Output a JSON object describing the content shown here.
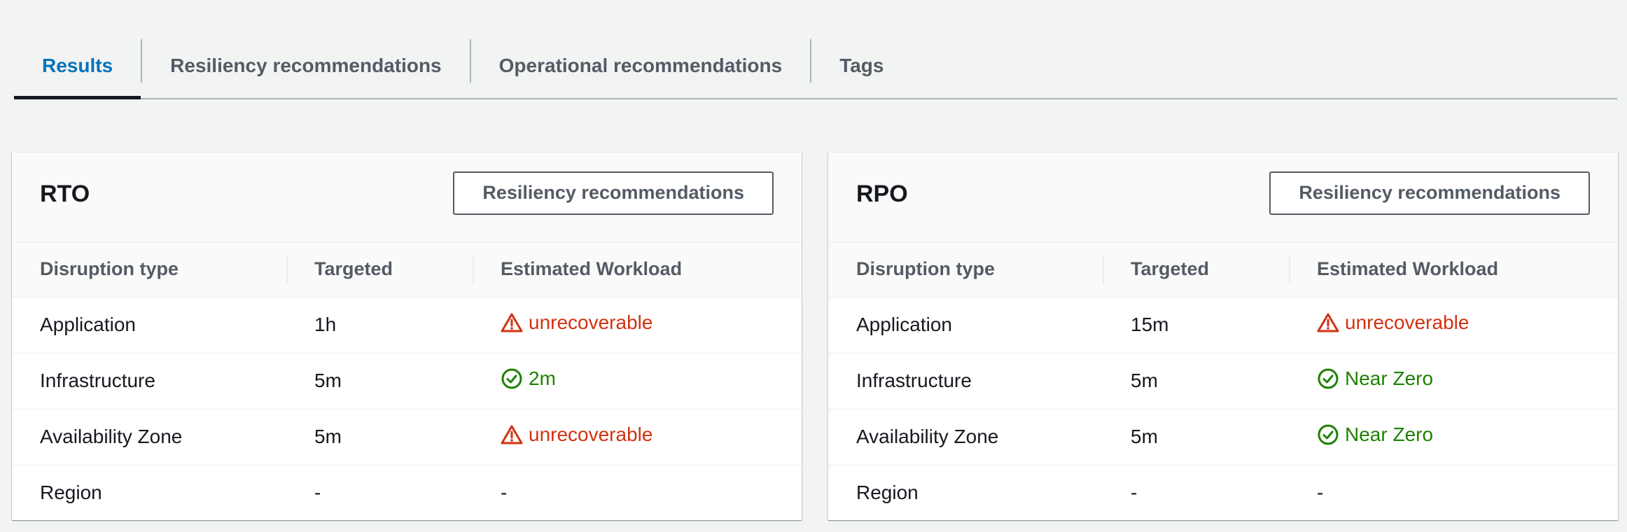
{
  "tabs": [
    {
      "label": "Results",
      "active": true
    },
    {
      "label": "Resiliency recommendations",
      "active": false
    },
    {
      "label": "Operational recommendations",
      "active": false
    },
    {
      "label": "Tags",
      "active": false
    }
  ],
  "columns": {
    "disruption_type": "Disruption type",
    "targeted": "Targeted",
    "estimated": "Estimated Workload"
  },
  "rto": {
    "title": "RTO",
    "button": "Resiliency recommendations",
    "rows": [
      {
        "type": "Application",
        "targeted": "1h",
        "estimate": "unrecoverable",
        "status": "warning-icon"
      },
      {
        "type": "Infrastructure",
        "targeted": "5m",
        "estimate": "2m",
        "status": "check-circle-icon"
      },
      {
        "type": "Availability Zone",
        "targeted": "5m",
        "estimate": "unrecoverable",
        "status": "warning-icon"
      },
      {
        "type": "Region",
        "targeted": "-",
        "estimate": "-",
        "status": "none"
      }
    ]
  },
  "rpo": {
    "title": "RPO",
    "button": "Resiliency recommendations",
    "rows": [
      {
        "type": "Application",
        "targeted": "15m",
        "estimate": "unrecoverable",
        "status": "warning-icon"
      },
      {
        "type": "Infrastructure",
        "targeted": "5m",
        "estimate": "Near Zero",
        "status": "check-circle-icon"
      },
      {
        "type": "Availability Zone",
        "targeted": "5m",
        "estimate": "Near Zero",
        "status": "check-circle-icon"
      },
      {
        "type": "Region",
        "targeted": "-",
        "estimate": "-",
        "status": "none"
      }
    ]
  },
  "colors": {
    "error": "#d13212",
    "success": "#1d8102",
    "active_tab": "#0073bb",
    "background": "#f2f3f3"
  }
}
